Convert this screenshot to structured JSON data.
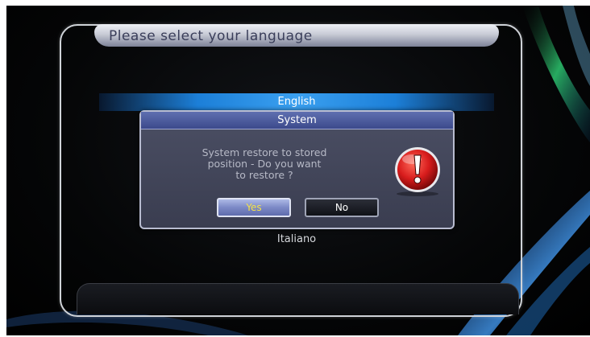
{
  "title": "Please select your language",
  "languages": {
    "selected": "English",
    "other": "Italiano"
  },
  "dialog": {
    "title": "System",
    "message": "System restore to stored\nposition -   Do you want\nto restore ?",
    "yes_label": "Yes",
    "no_label": "No",
    "focused_button": "Yes",
    "icon": "warning-icon"
  },
  "colors": {
    "highlight": "#2a90e8",
    "dialog_header": "#4a58a0",
    "yes_text": "#f4e24a",
    "warning": "#d81c1c"
  }
}
